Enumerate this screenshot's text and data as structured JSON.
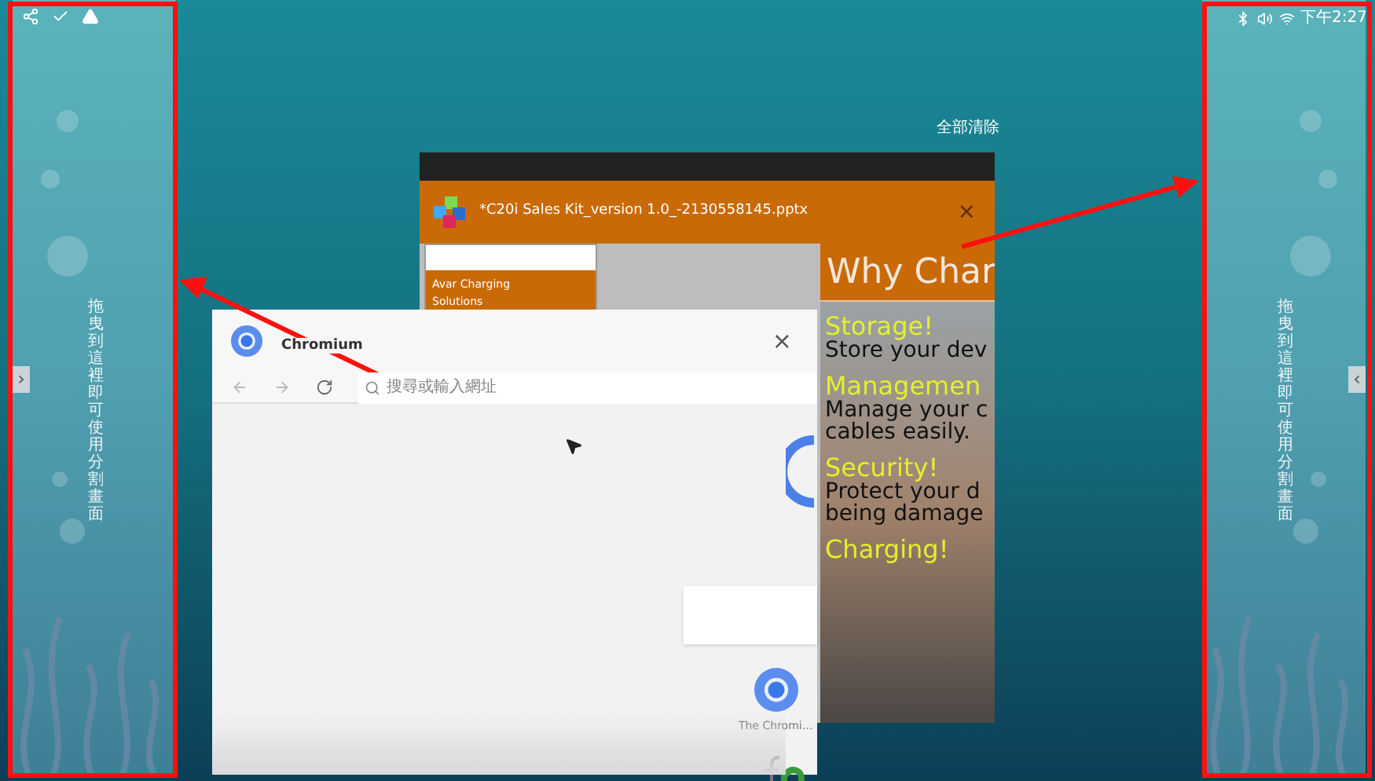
{
  "status_bar": {
    "time": "下午2:27"
  },
  "clear_all": "全部清除",
  "split_zones": [
    {
      "hint": "拖曳到這裡即可使用分割畫面",
      "handle": "›"
    },
    {
      "hint": "拖曳到這裡即可使用分割畫面",
      "handle": "‹"
    }
  ],
  "recent_apps": [
    {
      "kind": "document",
      "title": "*C20i Sales Kit_version 1.0_-2130558145.pptx",
      "close": "×",
      "thumbnail_lines": [
        "Avar Charging",
        "Solutions"
      ],
      "slide_heading": "Why Char",
      "slide_blocks": [
        {
          "heading": "Storage!",
          "lines": [
            "Store your dev"
          ]
        },
        {
          "heading": "Managemen",
          "lines": [
            "Manage your c",
            "cables easily."
          ]
        },
        {
          "heading": "Security!",
          "lines": [
            "Protect your d",
            "being damage"
          ]
        },
        {
          "heading": "Charging!"
        }
      ]
    },
    {
      "kind": "browser",
      "title": "Chromium",
      "close": "×",
      "address_placeholder": "搜尋或輸入網址",
      "shortcut_label": "The Chromi…"
    }
  ]
}
